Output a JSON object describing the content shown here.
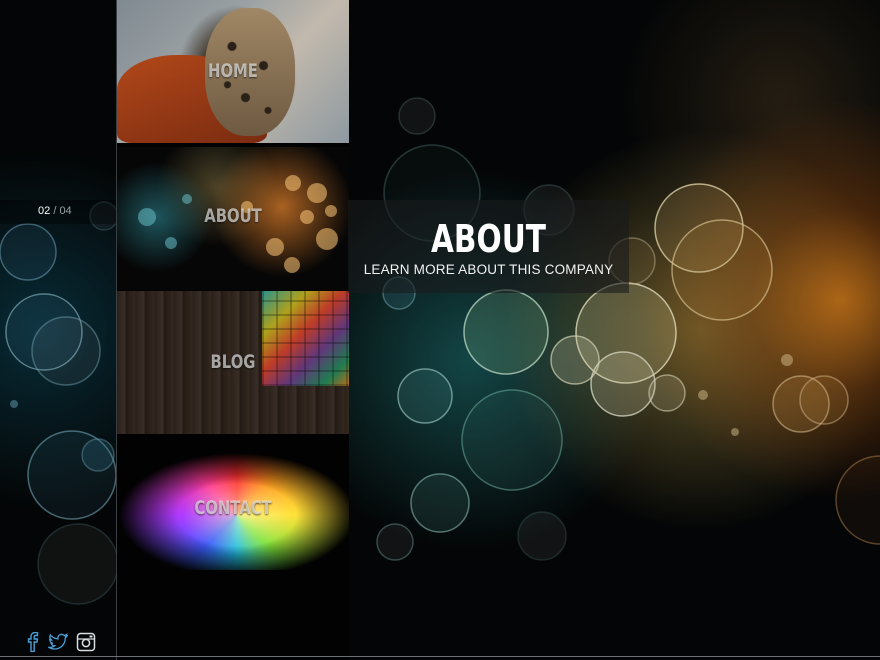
{
  "slider": {
    "current": "02",
    "separator": "/",
    "total": "04"
  },
  "nav": {
    "items": [
      {
        "label": "HOME"
      },
      {
        "label": "ABOUT"
      },
      {
        "label": "BLOG"
      },
      {
        "label": "CONTACT"
      }
    ]
  },
  "hero": {
    "title": "ABOUT",
    "subtitle": "LEARN MORE ABOUT THIS COMPANY"
  },
  "social": {
    "icons": [
      "facebook-icon",
      "twitter-icon",
      "instagram-icon"
    ],
    "color": "#4a9fd8"
  },
  "colors": {
    "background": "#050708",
    "nav_background": "#020202",
    "accent_orange": "#f08c1e",
    "accent_teal": "#2896a0"
  }
}
